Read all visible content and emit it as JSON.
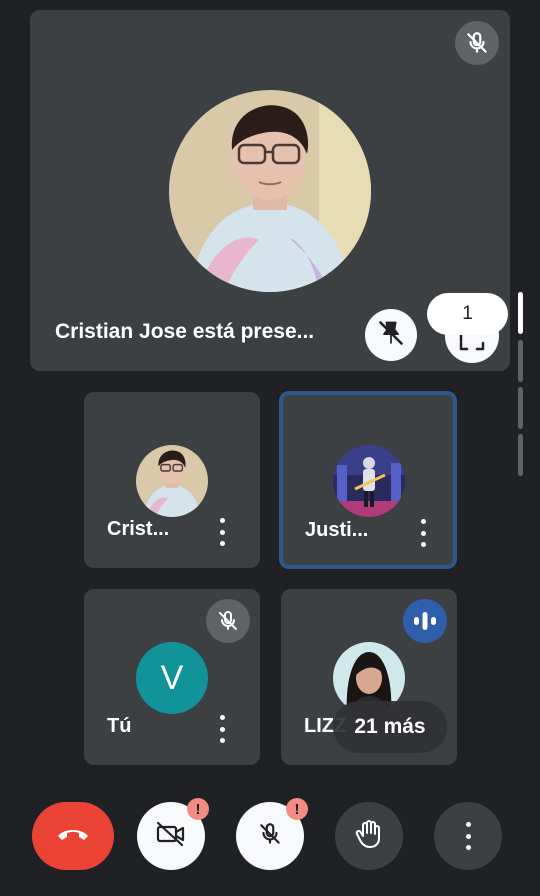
{
  "main_tile": {
    "name": "Cristian Jose está prese...",
    "participant_count": "1"
  },
  "tiles": [
    {
      "name": "Crist..."
    },
    {
      "name": "Justi..."
    },
    {
      "name": "Tú",
      "avatar_letter": "V"
    },
    {
      "name": "LIZZ"
    }
  ],
  "more_participants": "21 más",
  "controls": {
    "camera_alert": "!",
    "mic_alert": "!"
  },
  "colors": {
    "background": "#202124",
    "tile": "#3c4043",
    "active_border": "#2f5691",
    "hangup": "#ea4335",
    "avatar_v": "#12939a",
    "alert": "#f28b82"
  }
}
